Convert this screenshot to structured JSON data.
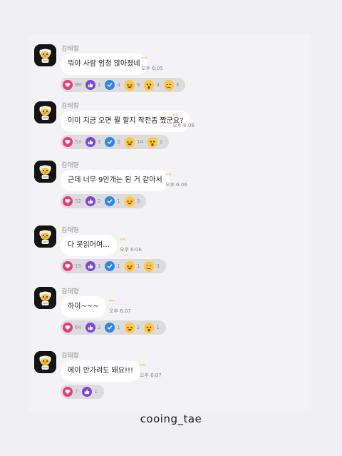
{
  "colors": {
    "heart": "#ea3a7a",
    "like": "#7a47d6",
    "check": "#2f86e6",
    "emoji": "#ffc83d",
    "quote": "#f4d35e"
  },
  "messages": [
    {
      "sender": "김태형",
      "text": "뭐야 사람 엄청 많아졌네",
      "time": "오후 6:05",
      "reactions": [
        {
          "type": "heart",
          "count": "99"
        },
        {
          "type": "like",
          "count": "1"
        },
        {
          "type": "check",
          "count": "4"
        },
        {
          "type": "laugh",
          "count": "9"
        },
        {
          "type": "wow",
          "count": "4"
        },
        {
          "type": "sad",
          "count": "3"
        }
      ]
    },
    {
      "sender": "김태형",
      "text": "이미 지금 오면 뭘 할지 작전좀 짰군요?",
      "time": "오후 6:06",
      "reactions": [
        {
          "type": "heart",
          "count": "53"
        },
        {
          "type": "like",
          "count": "3"
        },
        {
          "type": "check",
          "count": "2"
        },
        {
          "type": "laugh",
          "count": "14"
        },
        {
          "type": "wow",
          "count": "1"
        }
      ]
    },
    {
      "sender": "김태형",
      "text": "근데 너무 9만개는 된 거 같아서",
      "time": "오후 6:06",
      "reactions": [
        {
          "type": "heart",
          "count": "32"
        },
        {
          "type": "like",
          "count": "2"
        },
        {
          "type": "check",
          "count": "1"
        },
        {
          "type": "laugh",
          "count": "3"
        }
      ]
    },
    {
      "sender": "김태형",
      "text": "다 못읽어여…",
      "time": "오후 6:06",
      "reactions": [
        {
          "type": "heart",
          "count": "19"
        },
        {
          "type": "like",
          "count": "1"
        },
        {
          "type": "check",
          "count": "1"
        },
        {
          "type": "laugh",
          "count": "1"
        },
        {
          "type": "sad",
          "count": "3"
        }
      ]
    },
    {
      "sender": "김태형",
      "text": "하이~~~",
      "time": "오후 6:07",
      "reactions": [
        {
          "type": "heart",
          "count": "64"
        },
        {
          "type": "like",
          "count": "2"
        },
        {
          "type": "check",
          "count": "1"
        },
        {
          "type": "laugh",
          "count": "2"
        },
        {
          "type": "wow",
          "count": "1"
        }
      ]
    },
    {
      "sender": "김태형",
      "text": "에이 안가려도 돼요!!!",
      "time": "오후 6:07",
      "reactions": [
        {
          "type": "heart",
          "count": "7"
        },
        {
          "type": "like",
          "count": "1"
        }
      ]
    }
  ],
  "footer": {
    "watermark": "cooing_tae"
  }
}
